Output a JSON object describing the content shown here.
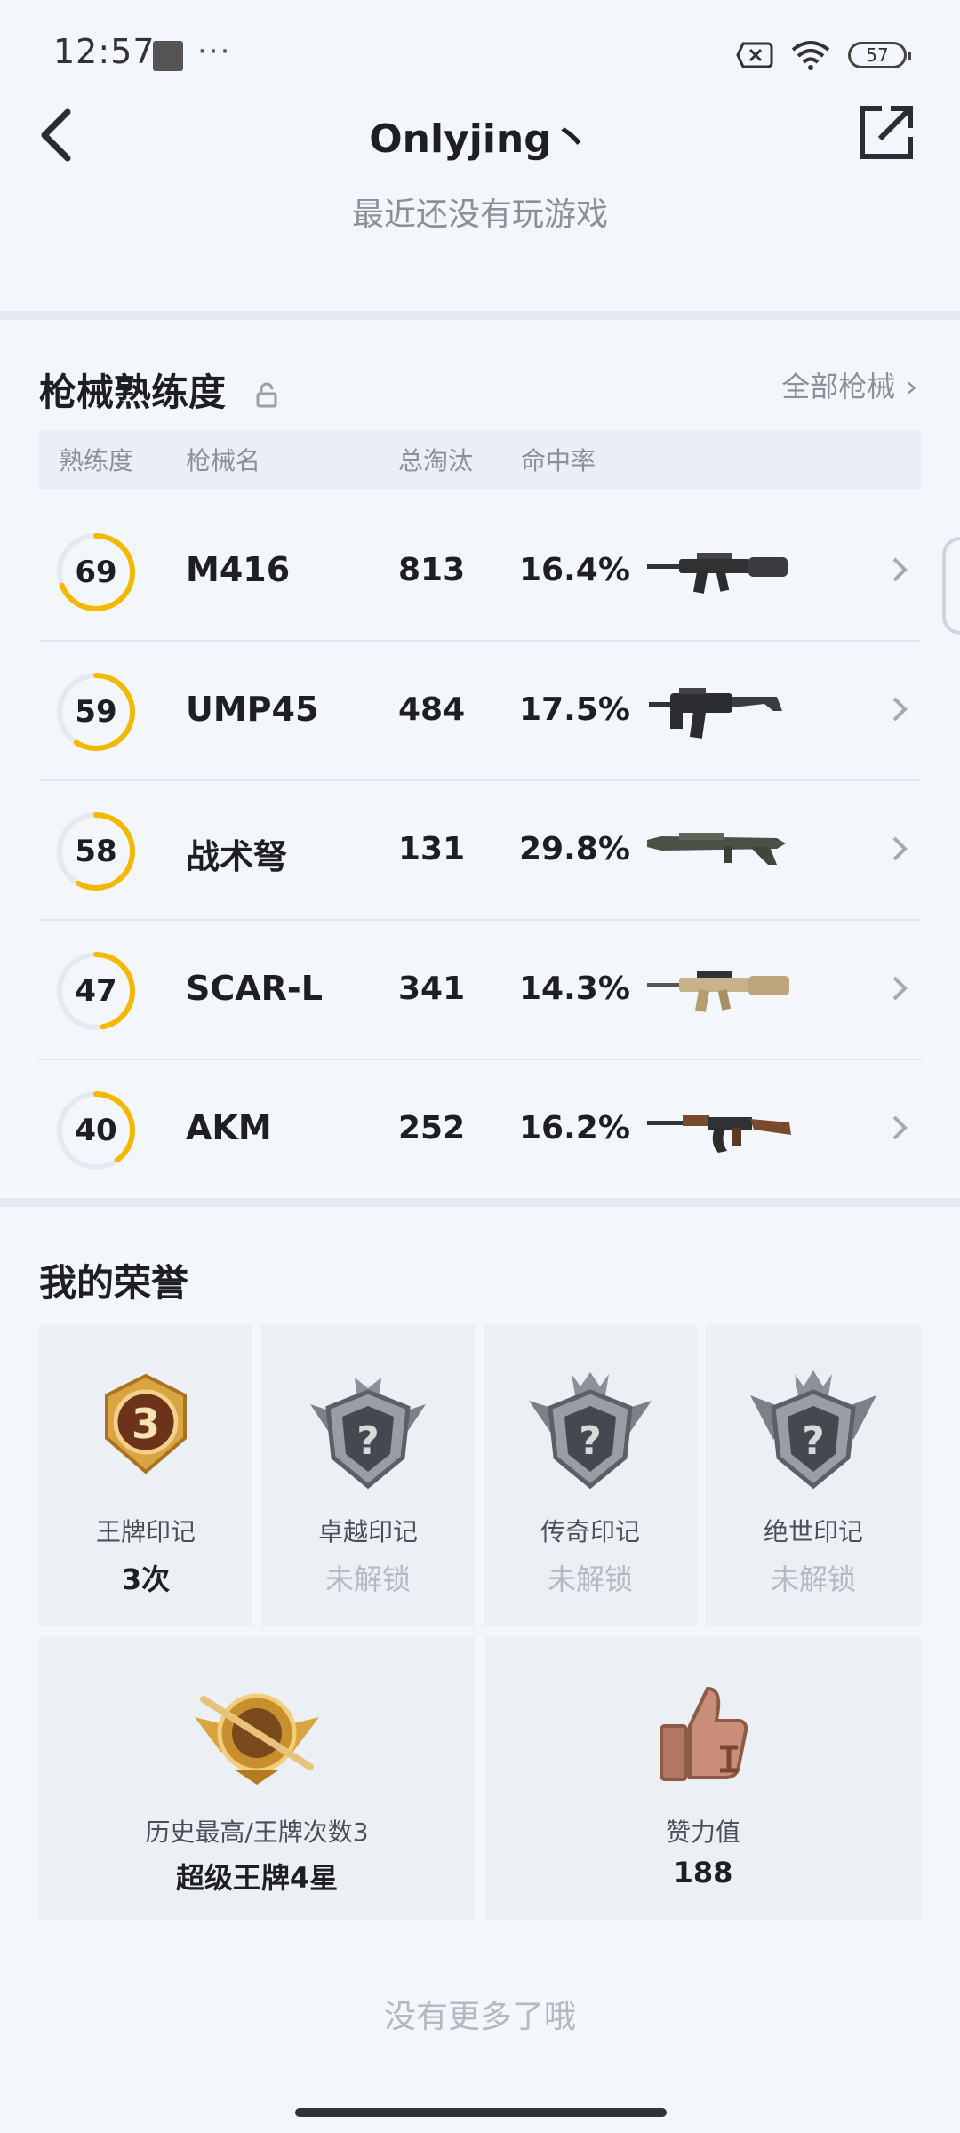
{
  "status_bar": {
    "time": "12:57",
    "dots": "···",
    "battery": "57"
  },
  "header": {
    "title": "Onlyjing丶",
    "subtitle": "最近还没有玩游戏"
  },
  "weapons_section": {
    "title": "枪械熟练度",
    "all_link": "全部枪械",
    "columns": {
      "proficiency": "熟练度",
      "name": "枪械名",
      "kills": "总淘汰",
      "accuracy": "命中率"
    },
    "rows": [
      {
        "level": "69",
        "name": "M416",
        "kills": "813",
        "accuracy": "16.4%",
        "progress": 0.69,
        "weapon_icon": "rifle-icon"
      },
      {
        "level": "59",
        "name": "UMP45",
        "kills": "484",
        "accuracy": "17.5%",
        "progress": 0.59,
        "weapon_icon": "smg-icon"
      },
      {
        "level": "58",
        "name": "战术弩",
        "kills": "131",
        "accuracy": "29.8%",
        "progress": 0.58,
        "weapon_icon": "crossbow-icon"
      },
      {
        "level": "47",
        "name": "SCAR-L",
        "kills": "341",
        "accuracy": "14.3%",
        "progress": 0.47,
        "weapon_icon": "rifle-icon"
      },
      {
        "level": "40",
        "name": "AKM",
        "kills": "252",
        "accuracy": "16.2%",
        "progress": 0.4,
        "weapon_icon": "rifle-icon"
      }
    ]
  },
  "honors_section": {
    "title": "我的荣誉",
    "marks": [
      {
        "label": "王牌印记",
        "value": "3次",
        "unlocked": true,
        "badge_text": "3"
      },
      {
        "label": "卓越印记",
        "value": "未解锁",
        "unlocked": false,
        "badge_text": "?"
      },
      {
        "label": "传奇印记",
        "value": "未解锁",
        "unlocked": false,
        "badge_text": "?"
      },
      {
        "label": "绝世印记",
        "value": "未解锁",
        "unlocked": false,
        "badge_text": "?"
      }
    ],
    "rank": {
      "label": "历史最高/王牌次数3",
      "value": "超级王牌4星"
    },
    "likes": {
      "label": "赞力值",
      "value": "188"
    }
  },
  "footer": {
    "text": "没有更多了哦"
  },
  "colors": {
    "accent": "#f5b800",
    "ring_track": "#e6e9ef",
    "gold": "#c99a3b",
    "silver": "#8d8f94"
  }
}
